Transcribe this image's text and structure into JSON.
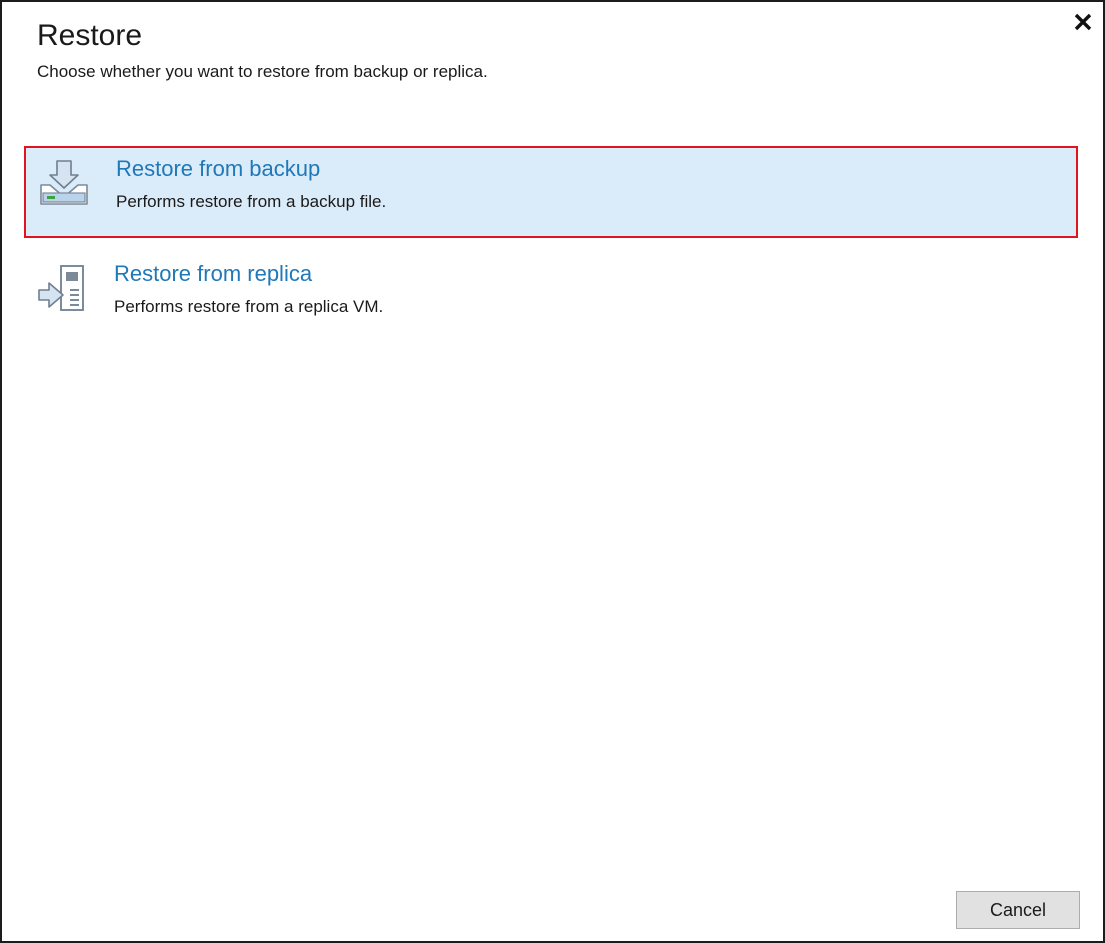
{
  "dialog": {
    "title": "Restore",
    "subtitle": "Choose whether you want to restore from backup or replica.",
    "close_icon": "close-icon"
  },
  "options": [
    {
      "title": "Restore from backup",
      "description": "Performs restore from a backup file.",
      "icon": "restore-backup-icon",
      "selected": true
    },
    {
      "title": "Restore from replica",
      "description": "Performs restore from a replica VM.",
      "icon": "restore-replica-icon",
      "selected": false
    }
  ],
  "footer": {
    "cancel_label": "Cancel"
  },
  "colors": {
    "link_blue": "#1f78b8",
    "selected_bg": "#daebfa",
    "highlight_border": "#e0141e",
    "button_bg": "#e1e1e1"
  }
}
